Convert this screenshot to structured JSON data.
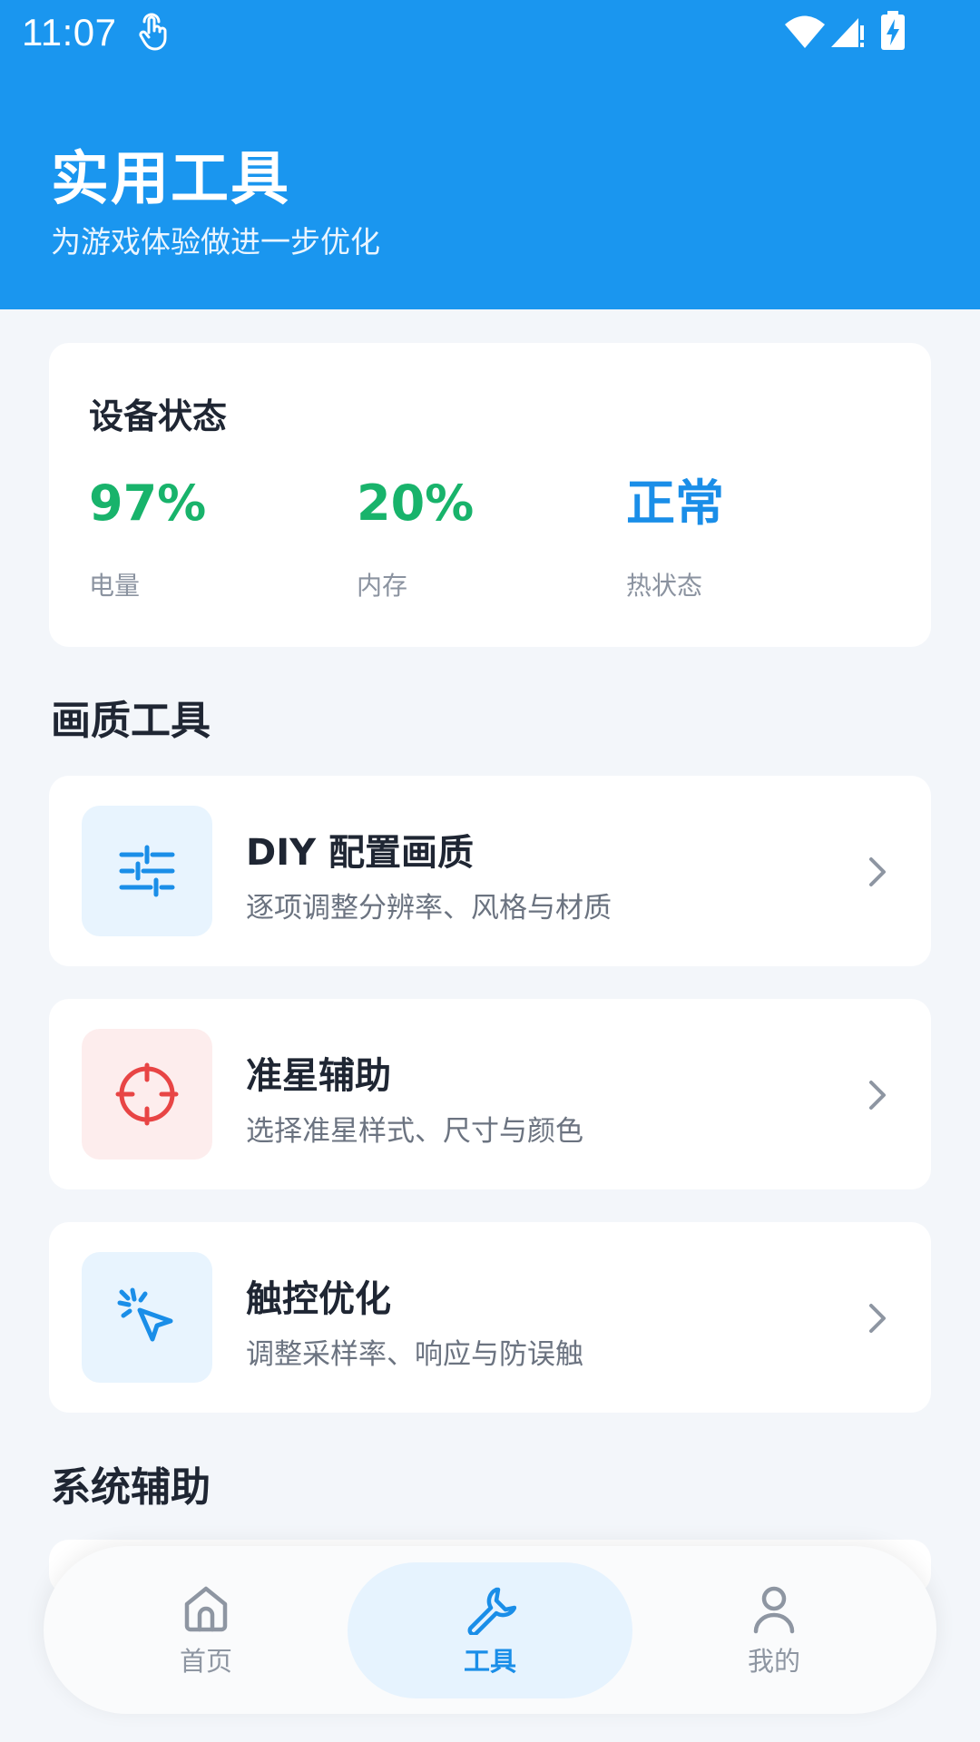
{
  "status_bar": {
    "time": "11:07"
  },
  "header": {
    "title": "实用工具",
    "subtitle": "为游戏体验做进一步优化"
  },
  "device_status": {
    "title": "设备状态",
    "metrics": [
      {
        "value": "97%",
        "label": "电量",
        "color": "#18B36B"
      },
      {
        "value": "20%",
        "label": "内存",
        "color": "#18B36B"
      },
      {
        "value": "正常",
        "label": "热状态",
        "color": "#1A8EE8"
      }
    ]
  },
  "sections": {
    "quality_tools": "画质工具",
    "system_assist": "系统辅助"
  },
  "tools": [
    {
      "name": "DIY 配置画质",
      "desc": "逐项调整分辨率、风格与材质",
      "icon": "sliders-icon",
      "icon_bg": "#E8F4FE",
      "icon_color": "#1A8EE8"
    },
    {
      "name": "准星辅助",
      "desc": "选择准星样式、尺寸与颜色",
      "icon": "crosshair-icon",
      "icon_bg": "#FDEDED",
      "icon_color": "#E84545"
    },
    {
      "name": "触控优化",
      "desc": "调整采样率、响应与防误触",
      "icon": "cursor-click-icon",
      "icon_bg": "#E8F4FE",
      "icon_color": "#1A8EE8"
    }
  ],
  "nav": {
    "items": [
      {
        "label": "首页",
        "icon": "home-icon",
        "active": false
      },
      {
        "label": "工具",
        "icon": "wrench-icon",
        "active": true
      },
      {
        "label": "我的",
        "icon": "user-icon",
        "active": false
      }
    ]
  },
  "colors": {
    "header_bg": "#1A96EF",
    "page_bg": "#F3F6FA",
    "accent": "#1A8EE8",
    "nav_inactive": "#8E96A2"
  }
}
